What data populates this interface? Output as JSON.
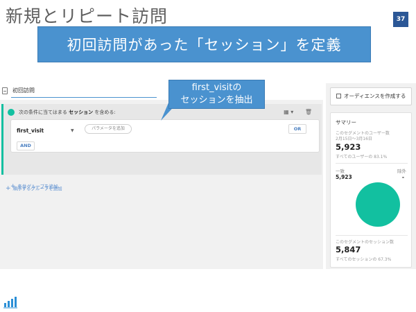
{
  "slide": {
    "title": "新規とリピート訪問",
    "page_number": "37",
    "banner": "初回訪問があった「セッション」を定義",
    "callout_line1": "first_visitの",
    "callout_line2": "セッションを抽出"
  },
  "segment_editor": {
    "segment_name": "初回訪問",
    "condition_header_prefix": "次の条件に当てはまる",
    "condition_header_bold": "セッション",
    "condition_header_suffix": "を含める:",
    "dimension": "first_visit",
    "parameter_button": "パラメータを追加",
    "or_button": "OR",
    "and_button": "AND",
    "add_condition_group": "条件グループを追加",
    "add_sequence_group": "順序するグループを追加"
  },
  "right_panel": {
    "audience_button": "オーディエンスを作成する",
    "summary_title": "サマリー",
    "users_label": "このセグメントのユーザー数",
    "date_range": "2月15日〜3月16日",
    "users_value": "5,923",
    "users_share": "すべてのユーザーの 83.1%",
    "match_label": "一致",
    "exclude_label": "除外",
    "match_value": "5,923",
    "exclude_value": "-",
    "sessions_label": "このセグメントのセッション数",
    "sessions_value": "5,847",
    "sessions_share": "すべてのセッションの 67.3%"
  },
  "colors": {
    "banner": "#4a92cf",
    "title_badge": "#2b5796",
    "teal": "#12c0a0",
    "link_blue": "#5b8fd0"
  }
}
